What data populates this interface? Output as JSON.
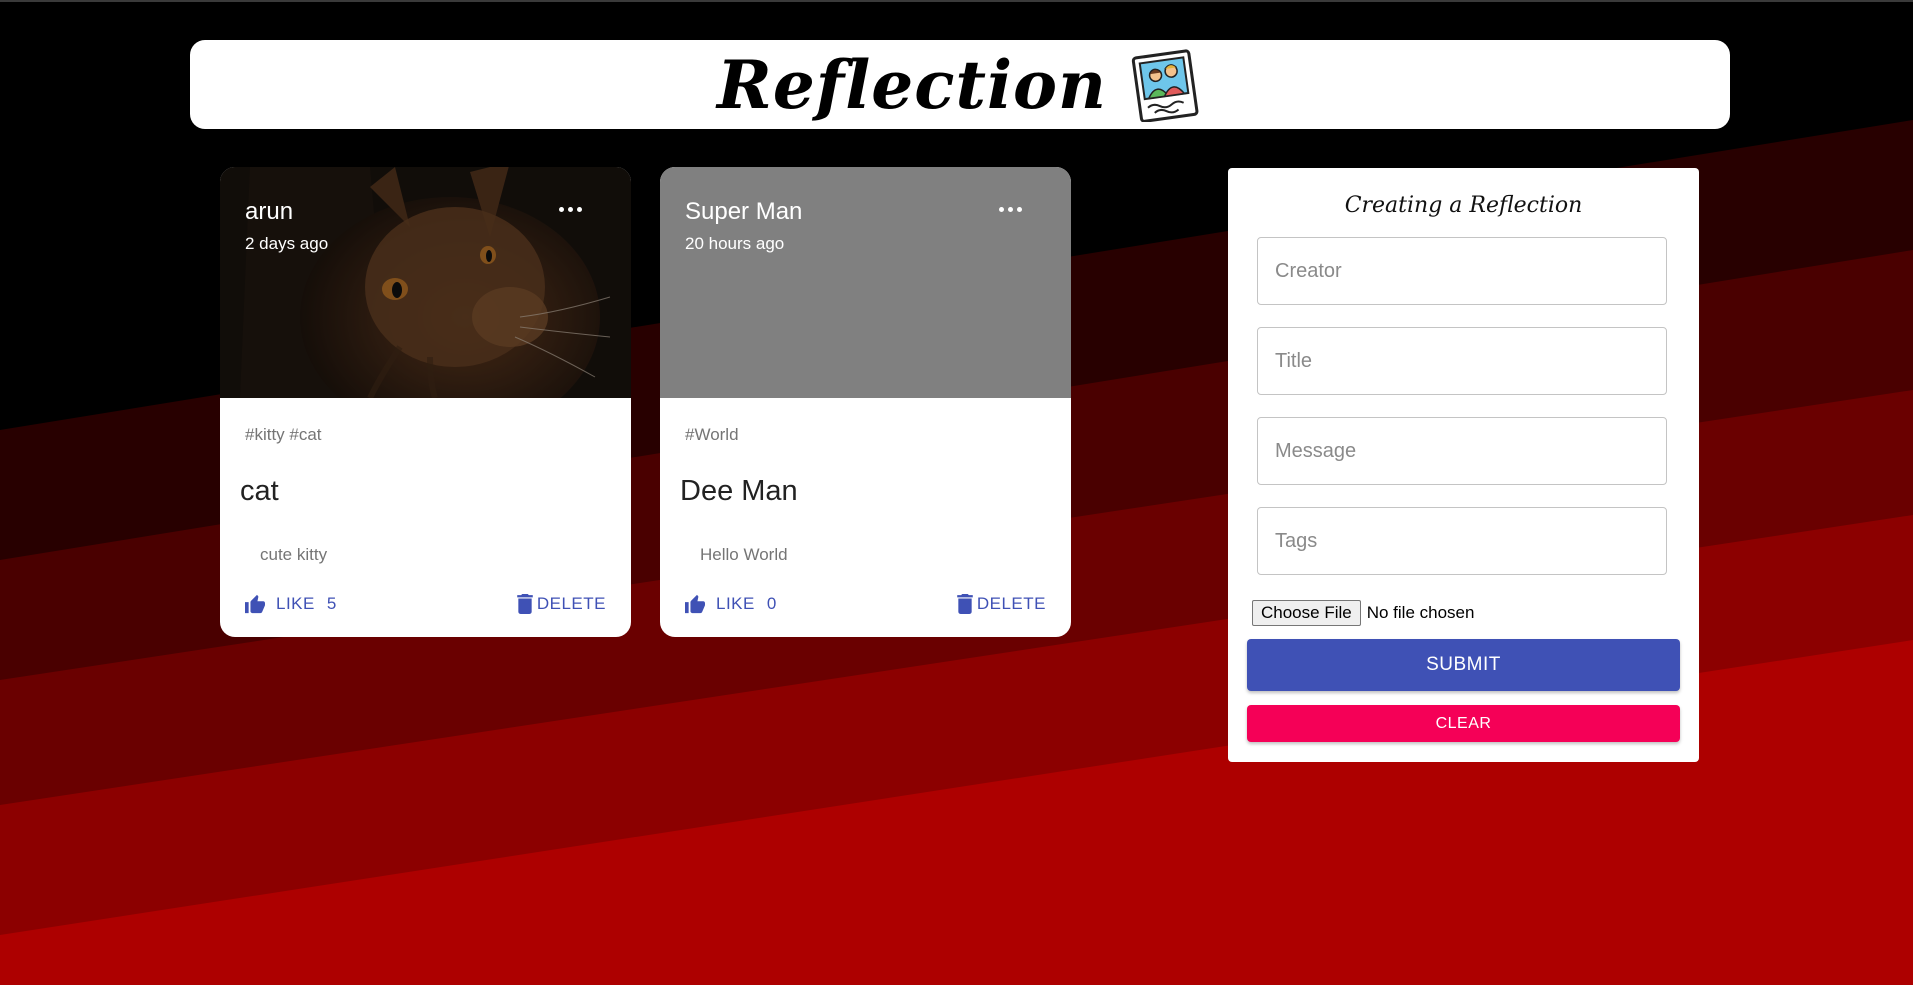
{
  "app": {
    "title": "Reflection",
    "logo_icon": "polaroid-photo-icon"
  },
  "posts": [
    {
      "creator": "arun",
      "time": "2 days ago",
      "image": "cat-photo",
      "tags": "#kitty #cat",
      "title": "cat",
      "message": "cute kitty",
      "like_label": "LIKE",
      "like_count": "5",
      "delete_label": "DELETE"
    },
    {
      "creator": "Super Man",
      "time": "20 hours ago",
      "image": "placeholder-gray",
      "tags": "#World",
      "title": "Dee Man",
      "message": "Hello World",
      "like_label": "LIKE",
      "like_count": "0",
      "delete_label": "DELETE"
    }
  ],
  "form": {
    "title": "Creating a Reflection",
    "creator_placeholder": "Creator",
    "title_placeholder": "Title",
    "message_placeholder": "Message",
    "tags_placeholder": "Tags",
    "file_button": "Choose File",
    "file_status": "No file chosen",
    "submit_label": "SUBMIT",
    "clear_label": "CLEAR"
  },
  "colors": {
    "primary": "#3f51b5",
    "secondary": "#f50057",
    "background_dark": "#000000",
    "background_red": "#b00000"
  }
}
